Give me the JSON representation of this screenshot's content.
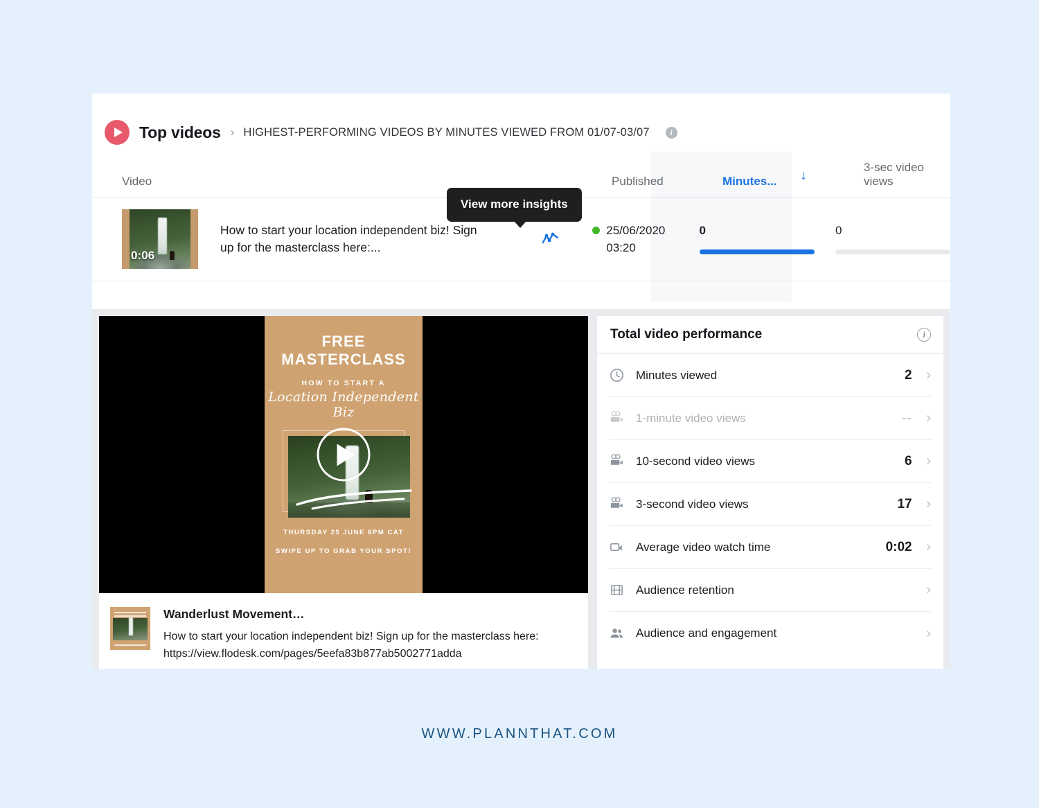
{
  "page": {
    "background_color": "#e4f1fd",
    "footer_text": "WWW.PLANNTHAT.COM"
  },
  "top_card": {
    "play_icon": "play-circle-icon",
    "title": "Top videos",
    "separator": "›",
    "subtitle": "HIGHEST-PERFORMING VIDEOS BY MINUTES VIEWED FROM 01/07-03/07",
    "info_icon": "info-icon"
  },
  "tooltip": {
    "text": "View more insights"
  },
  "table": {
    "columns": [
      {
        "key": "video",
        "label": "Video"
      },
      {
        "key": "insights",
        "label": ""
      },
      {
        "key": "published",
        "label": "Published"
      },
      {
        "key": "minutes",
        "label": "Minutes...",
        "sorted": true,
        "sort_direction": "↓",
        "accent_color": "#1b74e4"
      },
      {
        "key": "three_sec",
        "label": "3-sec video views"
      }
    ],
    "rows": [
      {
        "thumbnail": {
          "duration": "0:06",
          "alt": "waterfall-thumbnail"
        },
        "title": "How to start your location independent biz! Sign up for the masterclass here:...",
        "insights_icon": "trend-line-icon",
        "status_dot_color": "#42b72a",
        "published_date": "25/06/2020",
        "published_time": "03:20",
        "minutes_value": "0",
        "minutes_bar_color": "#1b74e4",
        "three_sec_value": "0",
        "three_sec_bar_color": "#e8eaec"
      }
    ]
  },
  "post_preview": {
    "story": {
      "headline": "FREE MASTERCLASS",
      "subhead": "HOW TO START A",
      "script_line": "Location Independent Biz",
      "footer_line_1": "THURSDAY 25 JUNE 6PM CAT",
      "footer_line_2": "SWIPE UP TO GRAB YOUR SPOT!",
      "play_icon": "play-button-icon",
      "background_color": "#cfa271"
    },
    "caption": {
      "thumbnail_alt": "story-thumbnail",
      "author": "Wanderlust Movement…",
      "body": "How to start your location independent biz! Sign up for the masterclass here: https://view.flodesk.com/pages/5eefa83b877ab5002771adda"
    }
  },
  "performance_panel": {
    "title": "Total video performance",
    "info_icon": "info-icon",
    "rows": [
      {
        "icon": "clock-icon",
        "label": "Minutes viewed",
        "value": "2",
        "muted": false
      },
      {
        "icon": "camera-icon",
        "label": "1-minute video views",
        "value": "--",
        "muted": true
      },
      {
        "icon": "camera-icon",
        "label": "10-second video views",
        "value": "6",
        "muted": false
      },
      {
        "icon": "camera-icon",
        "label": "3-second video views",
        "value": "17",
        "muted": false
      },
      {
        "icon": "camcorder-icon",
        "label": "Average video watch time",
        "value": "0:02",
        "muted": false
      },
      {
        "icon": "film-icon",
        "label": "Audience retention",
        "value": "",
        "muted": false
      },
      {
        "icon": "people-icon",
        "label": "Audience and engagement",
        "value": "",
        "muted": false
      }
    ],
    "chevron": "›"
  }
}
